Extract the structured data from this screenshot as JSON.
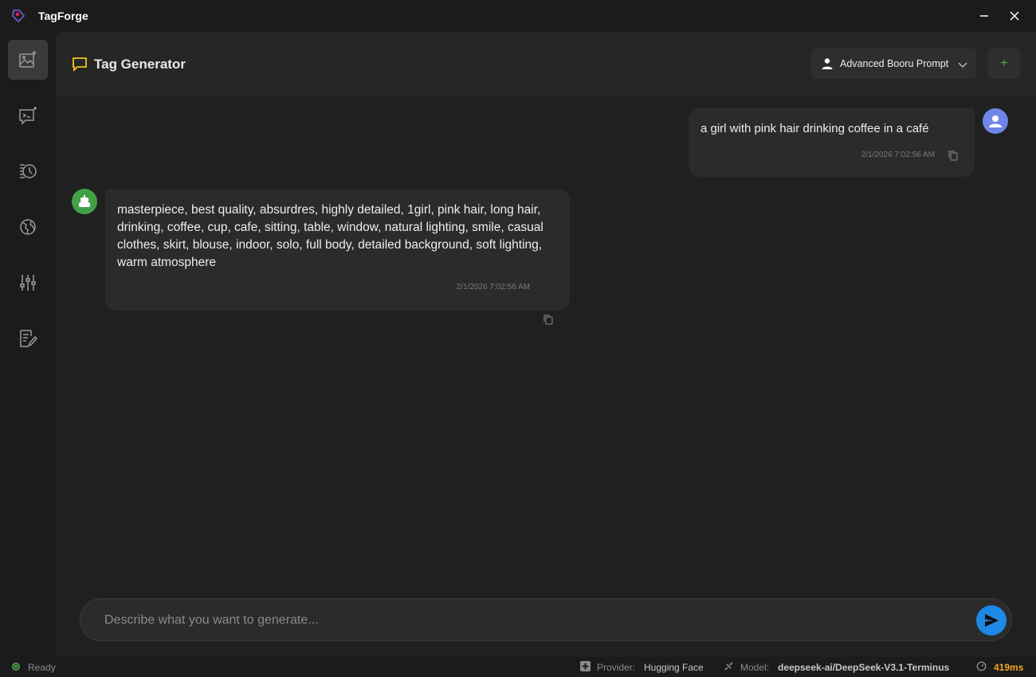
{
  "app": {
    "title": "TagForge"
  },
  "header": {
    "title": "Tag Generator",
    "preset": "Advanced Booru Prompt",
    "add_label": "+"
  },
  "sidebar": {
    "items": [
      {
        "name": "image-generator",
        "icon": "image-sparkle-icon",
        "active": true
      },
      {
        "name": "prompt-chat",
        "icon": "terminal-chat-icon",
        "active": false
      },
      {
        "name": "history",
        "icon": "history-icon",
        "active": false
      },
      {
        "name": "network",
        "icon": "globe-icon",
        "active": false
      },
      {
        "name": "settings",
        "icon": "sliders-icon",
        "active": false
      },
      {
        "name": "notes",
        "icon": "edit-note-icon",
        "active": false
      }
    ]
  },
  "messages": [
    {
      "role": "user",
      "text": "a girl with pink hair drinking coffee in a café",
      "time": "2/1/2026 7:02:56 AM"
    },
    {
      "role": "assistant",
      "text": "masterpiece, best quality, absurdres, highly detailed, 1girl, pink hair, long hair, drinking, coffee, cup, cafe, sitting, table, window, natural lighting, smile, casual clothes, skirt, blouse, indoor, solo, full body, detailed background, soft lighting, warm atmosphere",
      "time": "2/1/2026 7:02:56 AM"
    }
  ],
  "composer": {
    "placeholder": "Describe what you want to generate...",
    "value": ""
  },
  "status": {
    "state": "Ready",
    "provider_label": "Provider:",
    "provider": "Hugging Face",
    "model_label": "Model:",
    "model": "deepseek-ai/DeepSeek-V3.1-Terminus",
    "latency": "419ms"
  },
  "colors": {
    "accent_blue": "#1e88e5",
    "user_avatar": "#6f86e8",
    "bot_avatar": "#43a047",
    "header_icon": "#f5c518",
    "latency": "#f5a623",
    "status_ok": "#43a047"
  }
}
